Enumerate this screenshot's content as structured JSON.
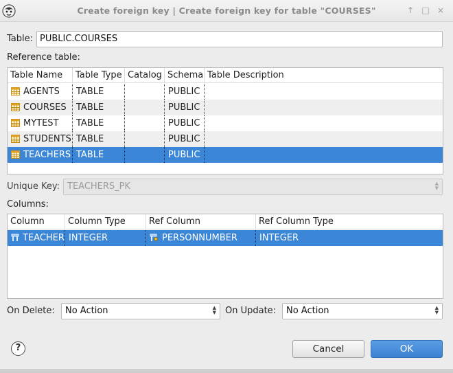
{
  "window": {
    "title": "Create foreign key | Create foreign key for table \"COURSES\"",
    "controls": [
      "↑",
      "□",
      "×"
    ]
  },
  "table_field": {
    "label": "Table:",
    "value": "PUBLIC.COURSES"
  },
  "reference_table": {
    "label": "Reference table:",
    "headers": [
      "Table Name",
      "Table Type",
      "Catalog",
      "Schema",
      "Table Description"
    ],
    "rows": [
      {
        "name": "AGENTS",
        "type": "TABLE",
        "catalog": "",
        "schema": "PUBLIC",
        "description": ""
      },
      {
        "name": "COURSES",
        "type": "TABLE",
        "catalog": "",
        "schema": "PUBLIC",
        "description": ""
      },
      {
        "name": "MYTEST",
        "type": "TABLE",
        "catalog": "",
        "schema": "PUBLIC",
        "description": ""
      },
      {
        "name": "STUDENTS",
        "type": "TABLE",
        "catalog": "",
        "schema": "PUBLIC",
        "description": ""
      },
      {
        "name": "TEACHERS",
        "type": "TABLE",
        "catalog": "",
        "schema": "PUBLIC",
        "description": "",
        "selected": true
      }
    ]
  },
  "unique_key": {
    "label": "Unique Key:",
    "value": "TEACHERS_PK"
  },
  "columns": {
    "label": "Columns:",
    "headers": [
      "Column",
      "Column Type",
      "Ref Column",
      "Ref Column Type"
    ],
    "rows": [
      {
        "column": "TEACHER",
        "column_type": "INTEGER",
        "ref_column": "PERSONNUMBER",
        "ref_column_type": "INTEGER",
        "selected": true
      }
    ]
  },
  "on_delete": {
    "label": "On Delete:",
    "value": "No Action"
  },
  "on_update": {
    "label": "On Update:",
    "value": "No Action"
  },
  "buttons": {
    "help": "?",
    "cancel": "Cancel",
    "ok": "OK"
  },
  "colors": {
    "selection": "#3b86d6",
    "primary_button": "#3b82d3",
    "table_icon": "#e0a020"
  }
}
